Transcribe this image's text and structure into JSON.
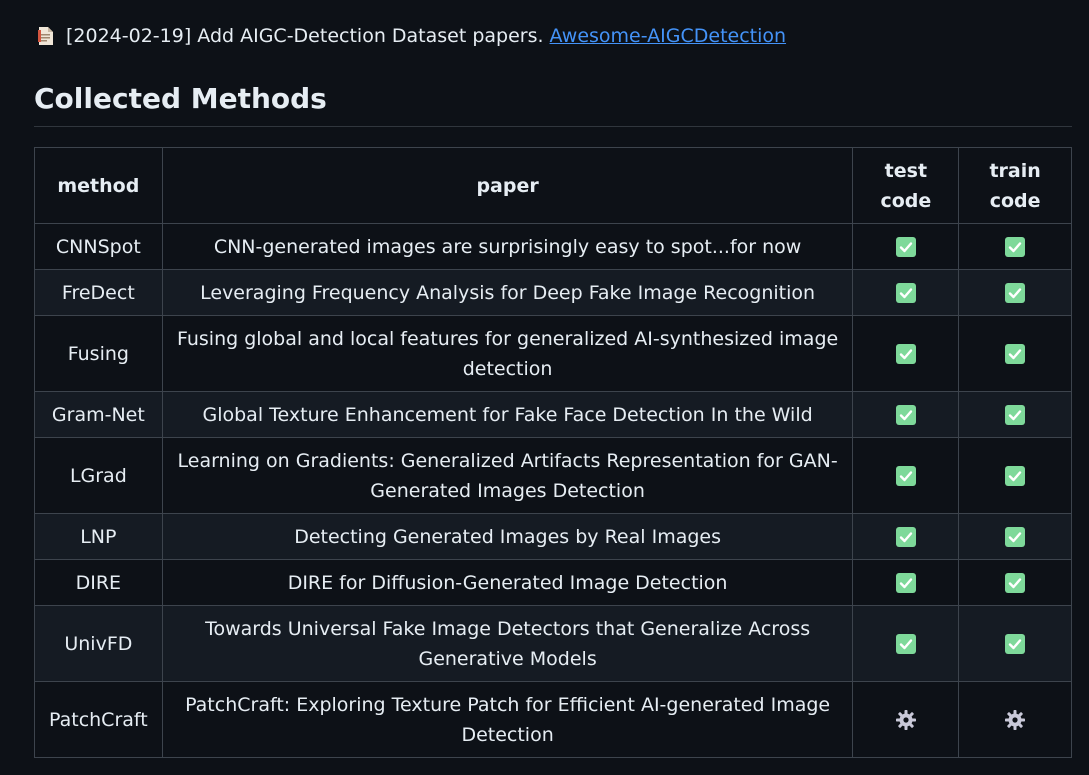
{
  "news": {
    "icon": "document-icon",
    "text": "[2024-02-19] Add AIGC-Detection Dataset papers.",
    "link": "Awesome-AIGCDetection"
  },
  "section": {
    "title": "Collected Methods"
  },
  "table": {
    "headers": {
      "method": "method",
      "paper": "paper",
      "test_code_1": "test",
      "test_code_2": "code",
      "train_code_1": "train",
      "train_code_2": "code"
    },
    "rows": [
      {
        "method": "CNNSpot",
        "paper": "CNN-generated images are surprisingly easy to spot...for now",
        "test": "check",
        "train": "check"
      },
      {
        "method": "FreDect",
        "paper": "Leveraging Frequency Analysis for Deep Fake Image Recognition",
        "test": "check",
        "train": "check"
      },
      {
        "method": "Fusing",
        "paper": "Fusing global and local features for generalized AI-synthesized image detection",
        "test": "check",
        "train": "check"
      },
      {
        "method": "Gram-Net",
        "paper": "Global Texture Enhancement for Fake Face Detection In the Wild",
        "test": "check",
        "train": "check"
      },
      {
        "method": "LGrad",
        "paper": "Learning on Gradients: Generalized Artifacts Representation for GAN-Generated Images Detection",
        "test": "check",
        "train": "check"
      },
      {
        "method": "LNP",
        "paper": "Detecting Generated Images by Real Images",
        "test": "check",
        "train": "check"
      },
      {
        "method": "DIRE",
        "paper": "DIRE for Diffusion-Generated Image Detection",
        "test": "check",
        "train": "check"
      },
      {
        "method": "UnivFD",
        "paper": "Towards Universal Fake Image Detectors that Generalize Across Generative Models",
        "test": "check",
        "train": "check"
      },
      {
        "method": "PatchCraft",
        "paper": "PatchCraft: Exploring Texture Patch for Efficient AI-generated Image Detection",
        "test": "gear",
        "train": "gear"
      }
    ]
  },
  "colors": {
    "background": "#0d1117",
    "text": "#e6edf3",
    "link": "#4493f8",
    "border": "#3d444d",
    "check": "#7ed99a",
    "gear": "#c9c9d9"
  }
}
